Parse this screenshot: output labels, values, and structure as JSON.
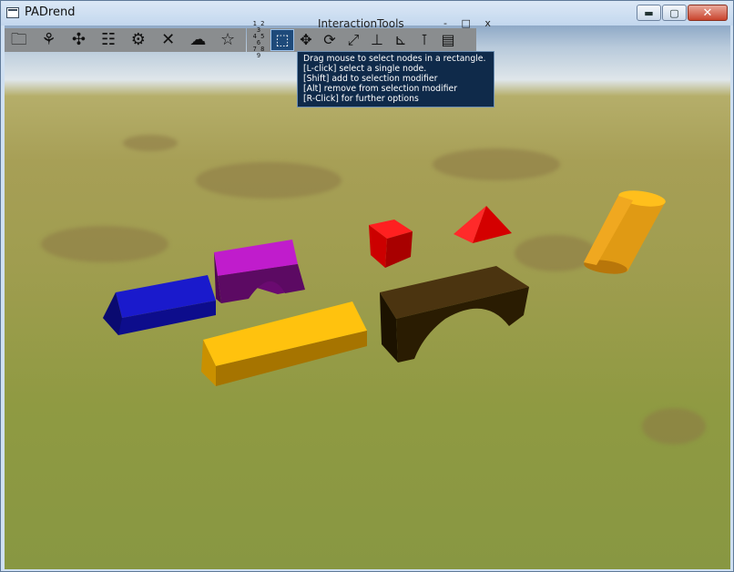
{
  "window": {
    "title": "PADrend",
    "minimize_icon": "minimize-icon",
    "maximize_icon": "maximize-icon",
    "close_icon": "close-icon"
  },
  "left_toolbar": {
    "items": [
      {
        "name": "folder-icon",
        "glyph": "🗀"
      },
      {
        "name": "scene-tree-icon",
        "glyph": "⚘"
      },
      {
        "name": "plugin-puzzle-icon",
        "glyph": "✣"
      },
      {
        "name": "list-icon",
        "glyph": "☷"
      },
      {
        "name": "gear-icon",
        "glyph": "⚙"
      },
      {
        "name": "tools-icon",
        "glyph": "✕"
      },
      {
        "name": "weather-icon",
        "glyph": "☁"
      },
      {
        "name": "star-icon",
        "glyph": "☆"
      }
    ]
  },
  "interaction_panel": {
    "title": "InteractionTools",
    "controls": "- □ x",
    "numpad": [
      "1 2 3",
      "4 5 6",
      "7 8 9"
    ],
    "tools": [
      {
        "name": "rect-select-icon",
        "glyph": "⬚",
        "active": true
      },
      {
        "name": "move-icon",
        "glyph": "✥",
        "active": false
      },
      {
        "name": "rotate-icon",
        "glyph": "⟳",
        "active": false
      },
      {
        "name": "scale-icon",
        "glyph": "⤢",
        "active": false
      },
      {
        "name": "snap-down-icon",
        "glyph": "⊥",
        "active": false
      },
      {
        "name": "axis-icon",
        "glyph": "⊾",
        "active": false
      },
      {
        "name": "measure-icon",
        "glyph": "⊺",
        "active": false
      },
      {
        "name": "notes-icon",
        "glyph": "▤",
        "active": false
      }
    ]
  },
  "tooltip": {
    "lines": [
      "Drag mouse to select nodes in a rectangle.",
      "[L-click] select a single node.",
      "[Shift] add to selection modifier",
      "[Alt] remove from selection modifier",
      "[R-Click] for further options"
    ]
  },
  "colors": {
    "blue_box": "#1515b5",
    "magenta_arch": "#b012b8",
    "yellow_box": "#ffc000",
    "red_cube": "#e00000",
    "red_pyramid": "#ff1a1a",
    "brown_arch": "#3d2a05",
    "orange_cylinder": "#e59a10"
  }
}
